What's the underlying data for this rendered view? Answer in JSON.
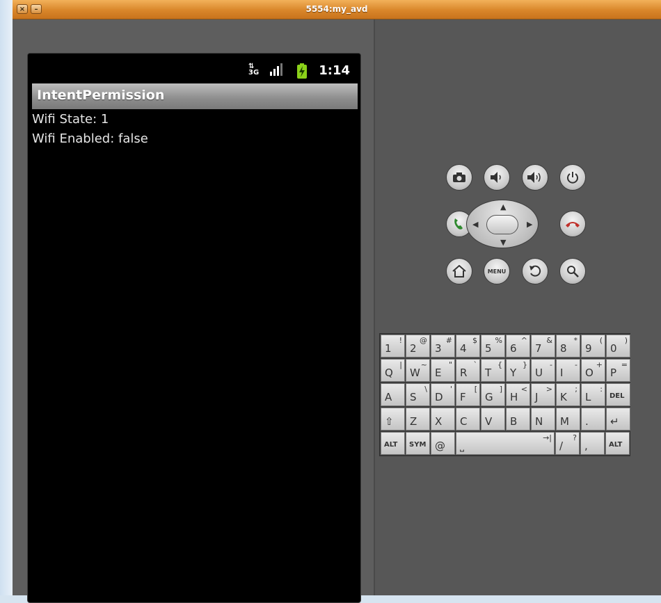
{
  "window": {
    "title": "5554:my_avd",
    "close_glyph": "×",
    "minimize_glyph": "–"
  },
  "statusbar": {
    "network_label": "3G",
    "time": "1:14",
    "icons": [
      "data-3g-icon",
      "signal-icon",
      "battery-charging-icon"
    ]
  },
  "app": {
    "title": "IntentPermission",
    "lines": [
      "Wifi State: 1",
      "Wifi Enabled: false"
    ]
  },
  "controls": {
    "row1": [
      "camera-icon",
      "volume-down-icon",
      "volume-up-icon",
      "power-icon"
    ],
    "row3": [
      "home-icon",
      "menu",
      "back-icon",
      "search-icon"
    ],
    "menu_label": "MENU",
    "call_color": "#2f8a2f",
    "end_call_color": "#c0302a"
  },
  "keyboard": {
    "row1": [
      {
        "k": "1",
        "a": "!"
      },
      {
        "k": "2",
        "a": "@"
      },
      {
        "k": "3",
        "a": "#"
      },
      {
        "k": "4",
        "a": "$"
      },
      {
        "k": "5",
        "a": "%"
      },
      {
        "k": "6",
        "a": "^"
      },
      {
        "k": "7",
        "a": "&"
      },
      {
        "k": "8",
        "a": "*"
      },
      {
        "k": "9",
        "a": "("
      },
      {
        "k": "0",
        "a": ")"
      }
    ],
    "row2": [
      {
        "k": "Q",
        "a": "|"
      },
      {
        "k": "W",
        "a": "~"
      },
      {
        "k": "E",
        "a": "\""
      },
      {
        "k": "R",
        "a": "`"
      },
      {
        "k": "T",
        "a": "{"
      },
      {
        "k": "Y",
        "a": "}"
      },
      {
        "k": "U",
        "a": "-"
      },
      {
        "k": "I",
        "a": "-"
      },
      {
        "k": "O",
        "a": "+"
      },
      {
        "k": "P",
        "a": "="
      }
    ],
    "row3": [
      {
        "k": "A",
        "a": ""
      },
      {
        "k": "S",
        "a": "\\"
      },
      {
        "k": "D",
        "a": "'"
      },
      {
        "k": "F",
        "a": "["
      },
      {
        "k": "G",
        "a": "]"
      },
      {
        "k": "H",
        "a": "<"
      },
      {
        "k": "J",
        "a": ">"
      },
      {
        "k": "K",
        "a": ";"
      },
      {
        "k": "L",
        "a": ":"
      },
      {
        "k": "DEL",
        "a": ""
      }
    ],
    "row4": [
      {
        "k": "⇧",
        "a": ""
      },
      {
        "k": "Z",
        "a": ""
      },
      {
        "k": "X",
        "a": ""
      },
      {
        "k": "C",
        "a": ""
      },
      {
        "k": "V",
        "a": ""
      },
      {
        "k": "B",
        "a": ""
      },
      {
        "k": "N",
        "a": ""
      },
      {
        "k": "M",
        "a": ""
      },
      {
        "k": ".",
        "a": ""
      },
      {
        "k": "↵",
        "a": ""
      }
    ],
    "row5": {
      "alt_left": "ALT",
      "sym": "SYM",
      "at": "@",
      "space_glyph": "⎵",
      "tab_glyph": "→|",
      "slash": "/",
      "slash_alt": "?",
      "comma": ",",
      "alt_right": "ALT"
    }
  }
}
